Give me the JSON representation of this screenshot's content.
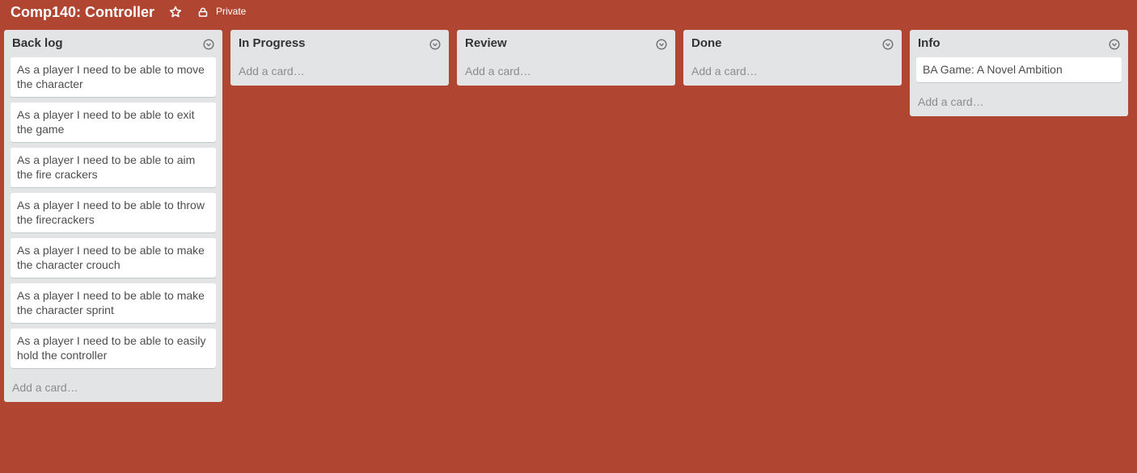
{
  "board": {
    "title": "Comp140: Controller",
    "privacy": "Private"
  },
  "icons": {
    "star": "star-icon",
    "lock": "lock-icon",
    "list_menu": "chevron-down-circle-icon"
  },
  "colors": {
    "background": "#b04632",
    "list_bg": "#e2e4e6",
    "card_bg": "#ffffff"
  },
  "lists": [
    {
      "title": "Back log",
      "cards": [
        "As a player I need to be able to move the character",
        "As a player I need to be able to exit the game",
        "As a player I need to be able to aim the fire crackers",
        "As a player I need to be able to throw the firecrackers",
        "As a player I need to be able to make the character crouch",
        "As a player I need to be able to make the character sprint",
        "As a player I need to be able to easily hold the controller"
      ],
      "add_card": "Add a card…"
    },
    {
      "title": "In Progress",
      "cards": [],
      "add_card": "Add a card…"
    },
    {
      "title": "Review",
      "cards": [],
      "add_card": "Add a card…"
    },
    {
      "title": "Done",
      "cards": [],
      "add_card": "Add a card…"
    },
    {
      "title": "Info",
      "cards": [
        "BA Game: A Novel Ambition"
      ],
      "add_card": "Add a card…"
    }
  ]
}
